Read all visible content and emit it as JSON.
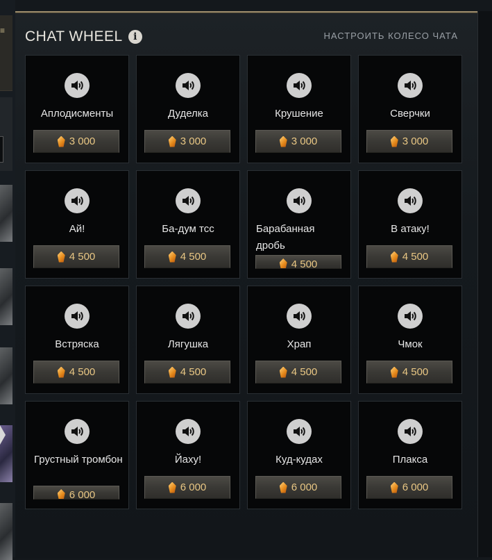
{
  "panel": {
    "title": "CHAT WHEEL",
    "info_icon": "info-icon",
    "customize_label": "НАСТРОИТЬ КОЛЕСО ЧАТА"
  },
  "side": {
    "glyph": "≡"
  },
  "cards": [
    {
      "label": "Аплодисменты",
      "price": "3 000"
    },
    {
      "label": "Дуделка",
      "price": "3 000"
    },
    {
      "label": "Крушение",
      "price": "3 000"
    },
    {
      "label": "Сверчки",
      "price": "3 000"
    },
    {
      "label": "Ай!",
      "price": "4 500"
    },
    {
      "label": "Ба-дум тсс",
      "price": "4 500"
    },
    {
      "label": "Барабанная дробь",
      "price": "4 500"
    },
    {
      "label": "В атаку!",
      "price": "4 500"
    },
    {
      "label": "Встряска",
      "price": "4 500"
    },
    {
      "label": "Лягушка",
      "price": "4 500"
    },
    {
      "label": "Храп",
      "price": "4 500"
    },
    {
      "label": "Чмок",
      "price": "4 500"
    },
    {
      "label": "Грустный тромбон",
      "price": "6 000"
    },
    {
      "label": "Йаху!",
      "price": "6 000"
    },
    {
      "label": "Куд-кудах",
      "price": "6 000"
    },
    {
      "label": "Плакса",
      "price": "6 000"
    }
  ],
  "colors": {
    "accent": "#e9c784",
    "panel_border": "#9a8a6a",
    "card_bg": "#060708"
  }
}
